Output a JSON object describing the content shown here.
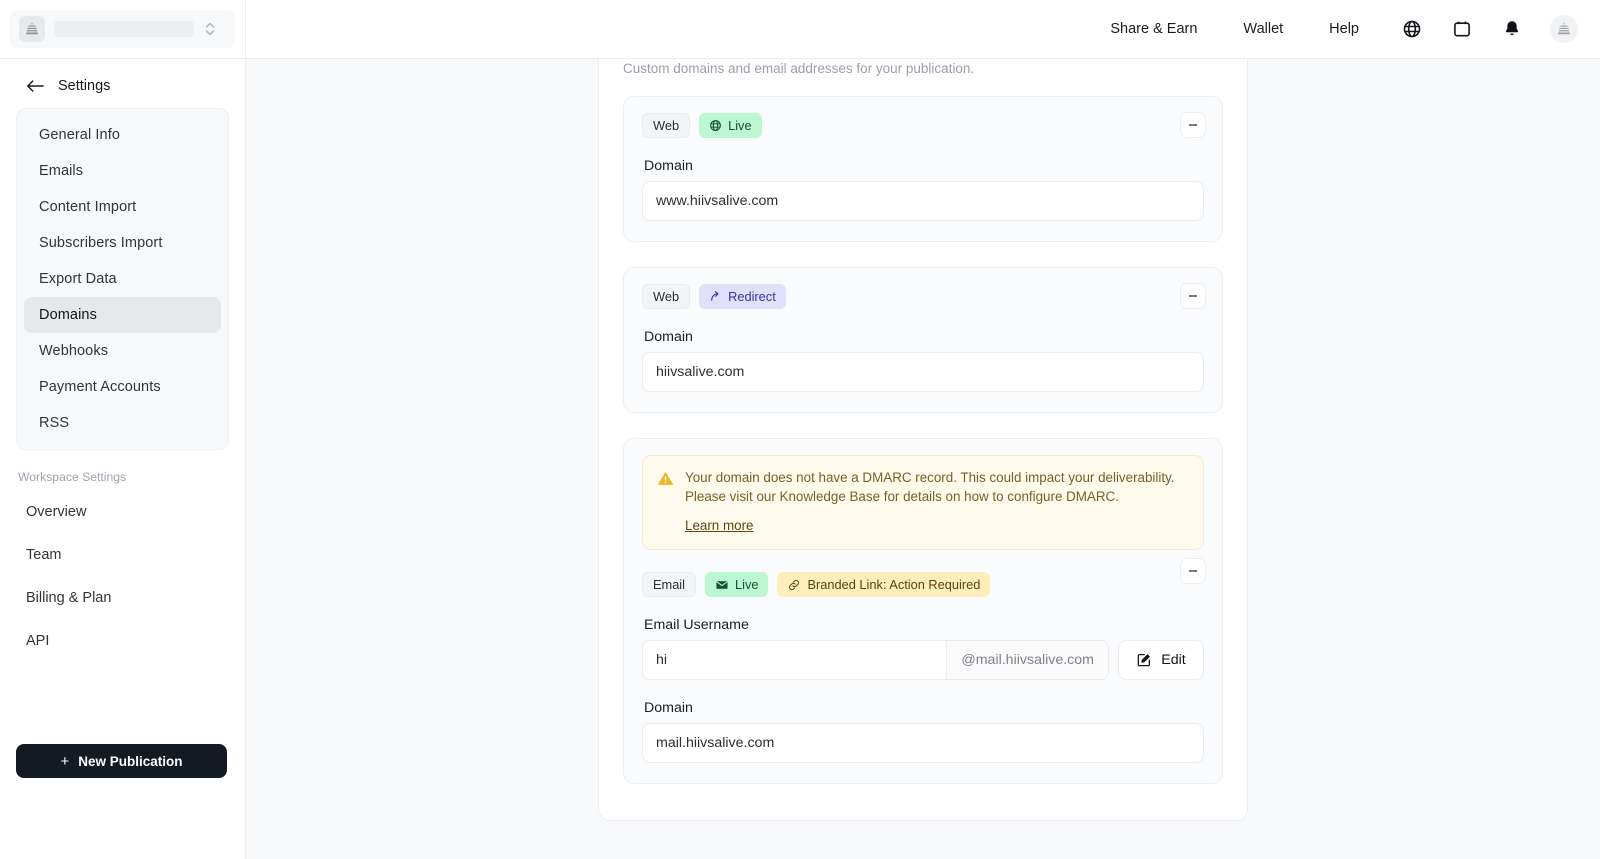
{
  "sidebar": {
    "publication_switcher": {
      "name": "",
      "icon": "publication-logo-icon"
    },
    "back_label": "Settings",
    "nav_items": [
      {
        "label": "General Info",
        "active": false
      },
      {
        "label": "Emails",
        "active": false
      },
      {
        "label": "Content Import",
        "active": false
      },
      {
        "label": "Subscribers Import",
        "active": false
      },
      {
        "label": "Export Data",
        "active": false
      },
      {
        "label": "Domains",
        "active": true
      },
      {
        "label": "Webhooks",
        "active": false
      },
      {
        "label": "Payment Accounts",
        "active": false
      },
      {
        "label": "RSS",
        "active": false
      }
    ],
    "workspace_heading": "Workspace Settings",
    "workspace_items": [
      {
        "label": "Overview"
      },
      {
        "label": "Team"
      },
      {
        "label": "Billing & Plan"
      },
      {
        "label": "API"
      }
    ],
    "new_publication_label": "New Publication"
  },
  "topbar": {
    "links": [
      {
        "label": "Share & Earn"
      },
      {
        "label": "Wallet"
      },
      {
        "label": "Help"
      }
    ],
    "icons": [
      "globe-icon",
      "calendar-icon",
      "bell-icon",
      "avatar"
    ]
  },
  "page": {
    "subtitle": "Custom domains and email addresses for your publication.",
    "cards": [
      {
        "id": "web-live",
        "badges": [
          {
            "text": "Web",
            "style": "plain",
            "icon": null
          },
          {
            "text": "Live",
            "style": "live",
            "icon": "globe-icon"
          }
        ],
        "fields": [
          {
            "label": "Domain",
            "value": "www.hiivsalive.com"
          }
        ],
        "warning": null,
        "username": null,
        "menu_icon": "kebab-menu-icon"
      },
      {
        "id": "web-redirect",
        "badges": [
          {
            "text": "Web",
            "style": "plain",
            "icon": null
          },
          {
            "text": "Redirect",
            "style": "redirect",
            "icon": "redirect-arrow-icon"
          }
        ],
        "fields": [
          {
            "label": "Domain",
            "value": "hiivsalive.com"
          }
        ],
        "warning": null,
        "username": null,
        "menu_icon": "kebab-menu-icon"
      },
      {
        "id": "email-live",
        "badges": [
          {
            "text": "Email",
            "style": "plain",
            "icon": null
          },
          {
            "text": "Live",
            "style": "live",
            "icon": "envelope-icon"
          },
          {
            "text": "Branded Link: Action Required",
            "style": "warn",
            "icon": "link-icon"
          }
        ],
        "warning": {
          "icon": "warning-triangle-icon",
          "text": "Your domain does not have a DMARC record. This could impact your deliverability. Please visit our Knowledge Base for details on how to configure DMARC.",
          "link_label": "Learn more"
        },
        "username": {
          "label": "Email Username",
          "value": "hi",
          "suffix": "@mail.hiivsalive.com",
          "edit_label": "Edit",
          "edit_icon": "edit-pencil-icon"
        },
        "fields": [
          {
            "label": "Domain",
            "value": "mail.hiivsalive.com"
          }
        ],
        "menu_icon": "kebab-menu-icon"
      }
    ]
  },
  "colors": {
    "accent_live_bg": "#bbf7d0",
    "accent_live_fg": "#14532d",
    "accent_redirect_bg": "#dfe1fa",
    "accent_redirect_fg": "#33369b",
    "accent_warn_bg": "#fdeeba",
    "accent_warn_fg": "#5e4408",
    "warning_panel_bg": "#fefbec",
    "page_bg": "#f7f8fa",
    "primary_button_bg": "#141a21"
  }
}
